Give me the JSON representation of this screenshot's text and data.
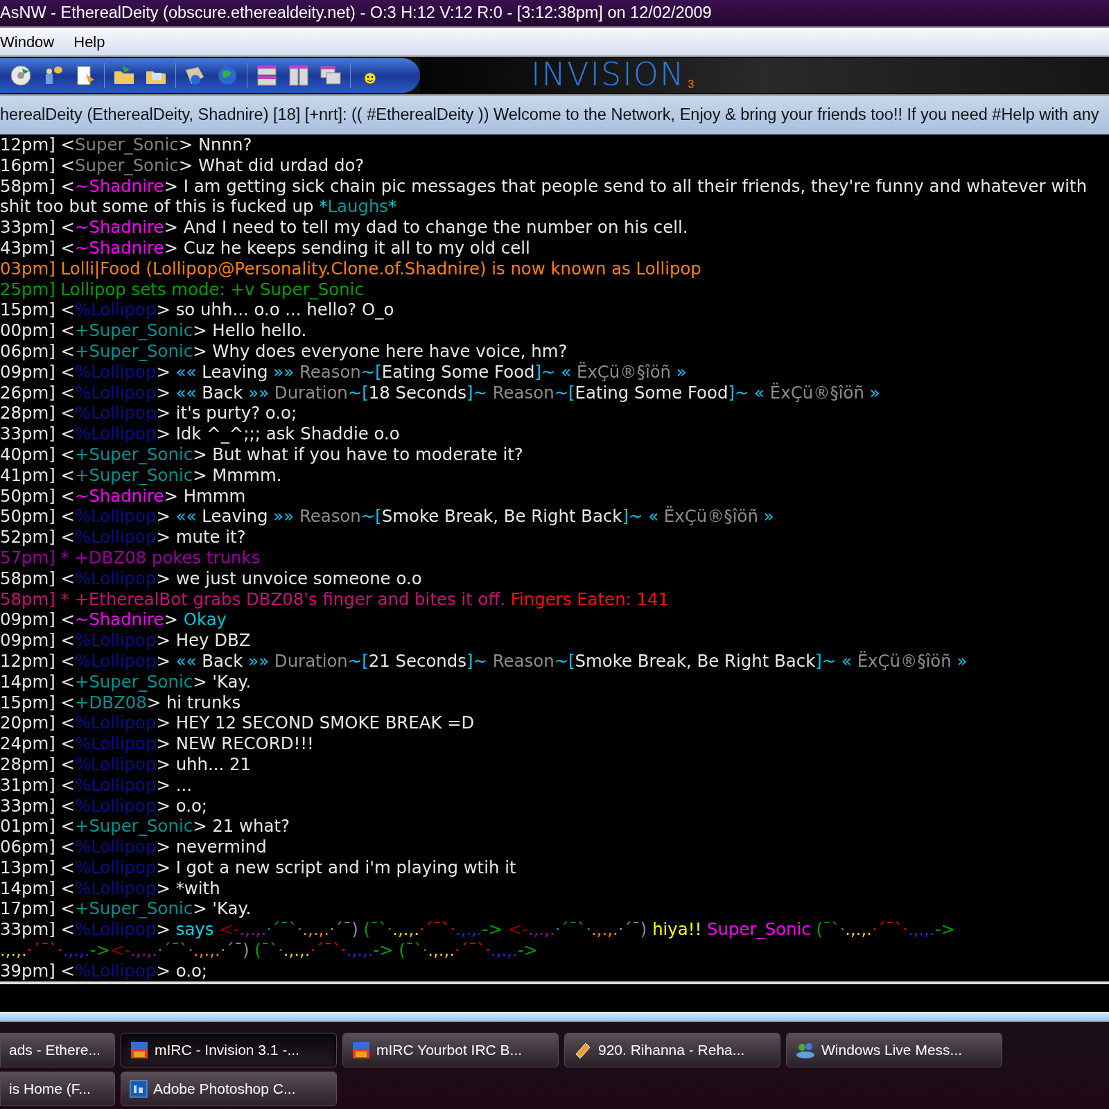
{
  "window": {
    "title": "AsNW - EtherealDeity (obscure.etherealdeity.net) - O:3 H:12 V:12 R:0 - [3:12:38pm] on 12/02/2009"
  },
  "menu": [
    "Window",
    "Help"
  ],
  "logo": {
    "text": "INVISION",
    "sub": "3"
  },
  "topic": "herealDeity (EtherealDeity, Shadnire) [18] [+nrt]: (( #EtherealDeity )) Welcome to the Network, Enjoy & bring your friends too!! If you need #Help with any",
  "chat": {
    "lines": [
      [
        {
          "text": "12pm] <",
          "color": "#e8e8e8"
        },
        {
          "text": "Super_Sonic",
          "color": "#7f7f7f"
        },
        {
          "text": "> Nnnn?",
          "color": "#e8e8e8"
        }
      ],
      [
        {
          "text": "16pm] <",
          "color": "#e8e8e8"
        },
        {
          "text": "Super_Sonic",
          "color": "#7f7f7f"
        },
        {
          "text": "> What did urdad do?",
          "color": "#e8e8e8"
        }
      ],
      [
        {
          "text": "58pm] <",
          "color": "#e8e8e8"
        },
        {
          "text": "~Shadnire",
          "color": "#ff00ff"
        },
        {
          "text": "> I am getting sick chain pic messages that people send to all their friends, they're funny and whatever with",
          "color": "#e8e8e8"
        }
      ],
      [
        {
          "text": "shit too but some of this is fucked up ",
          "color": "#e8e8e8"
        },
        {
          "text": "*",
          "color": "#00e0e0"
        },
        {
          "text": "Laughs",
          "color": "#009c9c"
        },
        {
          "text": "*",
          "color": "#00e0e0"
        }
      ],
      [
        {
          "text": "33pm] <",
          "color": "#e8e8e8"
        },
        {
          "text": "~Shadnire",
          "color": "#ff00ff"
        },
        {
          "text": "> And I need to tell my dad to change the number on his cell.",
          "color": "#e8e8e8"
        }
      ],
      [
        {
          "text": "43pm] <",
          "color": "#e8e8e8"
        },
        {
          "text": "~Shadnire",
          "color": "#ff00ff"
        },
        {
          "text": "> Cuz he keeps sending it all to my old cell",
          "color": "#e8e8e8"
        }
      ],
      [
        {
          "text": "03pm] Lolli|Food (Lollipop@Personality.Clone.of.Shadnire) is now known as Lollipop",
          "color": "#ff8000"
        }
      ],
      [
        {
          "text": "25pm] Lollipop sets mode: +v Super_Sonic",
          "color": "#00a000"
        }
      ],
      [
        {
          "text": "15pm] <",
          "color": "#e8e8e8"
        },
        {
          "text": "%Lollipop",
          "color": "#0c0c8c"
        },
        {
          "text": "> so uhh... o.o ... hello? O_o",
          "color": "#e8e8e8"
        }
      ],
      [
        {
          "text": "00pm] <",
          "color": "#e8e8e8"
        },
        {
          "text": "+Super_Sonic",
          "color": "#009393"
        },
        {
          "text": "> Hello hello.",
          "color": "#e8e8e8"
        }
      ],
      [
        {
          "text": "06pm] <",
          "color": "#e8e8e8"
        },
        {
          "text": "+Super_Sonic",
          "color": "#009393"
        },
        {
          "text": "> Why does everyone here have voice, hm?",
          "color": "#e8e8e8"
        }
      ],
      [
        {
          "text": "09pm] <",
          "color": "#e8e8e8"
        },
        {
          "text": "%Lollipop",
          "color": "#0c0c8c"
        },
        {
          "text": "> ",
          "color": "#e8e8e8"
        },
        {
          "text": "«« ",
          "color": "#00c8ff"
        },
        {
          "text": "Leaving",
          "color": "#e8e8e8"
        },
        {
          "text": " »» ",
          "color": "#00c8ff"
        },
        {
          "text": "Reason",
          "color": "#8c8c8c"
        },
        {
          "text": "~[",
          "color": "#00c8ff"
        },
        {
          "text": "Eating Some Food",
          "color": "#e8e8e8"
        },
        {
          "text": "]~ « ",
          "color": "#00c8ff"
        },
        {
          "text": "ËxÇü®§îöñ",
          "color": "#8c8c8c"
        },
        {
          "text": " »",
          "color": "#00c8ff"
        }
      ],
      [
        {
          "text": "26pm] <",
          "color": "#e8e8e8"
        },
        {
          "text": "%Lollipop",
          "color": "#0c0c8c"
        },
        {
          "text": "> ",
          "color": "#e8e8e8"
        },
        {
          "text": "«« ",
          "color": "#00c8ff"
        },
        {
          "text": "Back",
          "color": "#e8e8e8"
        },
        {
          "text": " »» ",
          "color": "#00c8ff"
        },
        {
          "text": "Duration",
          "color": "#8c8c8c"
        },
        {
          "text": "~[",
          "color": "#00c8ff"
        },
        {
          "text": "18 Seconds",
          "color": "#e8e8e8"
        },
        {
          "text": "]~ ",
          "color": "#00c8ff"
        },
        {
          "text": "Reason",
          "color": "#8c8c8c"
        },
        {
          "text": "~[",
          "color": "#00c8ff"
        },
        {
          "text": "Eating Some Food",
          "color": "#e8e8e8"
        },
        {
          "text": "]~ « ",
          "color": "#00c8ff"
        },
        {
          "text": "ËxÇü®§îöñ",
          "color": "#8c8c8c"
        },
        {
          "text": " »",
          "color": "#00c8ff"
        }
      ],
      [
        {
          "text": "28pm] <",
          "color": "#e8e8e8"
        },
        {
          "text": "%Lollipop",
          "color": "#0c0c8c"
        },
        {
          "text": "> it's purty? o.o;",
          "color": "#e8e8e8"
        }
      ],
      [
        {
          "text": "33pm] <",
          "color": "#e8e8e8"
        },
        {
          "text": "%Lollipop",
          "color": "#0c0c8c"
        },
        {
          "text": "> Idk ^_^;;; ask Shaddie o.o",
          "color": "#e8e8e8"
        }
      ],
      [
        {
          "text": "40pm] <",
          "color": "#e8e8e8"
        },
        {
          "text": "+Super_Sonic",
          "color": "#009393"
        },
        {
          "text": "> But what if you have to moderate it?",
          "color": "#e8e8e8"
        }
      ],
      [
        {
          "text": "41pm] <",
          "color": "#e8e8e8"
        },
        {
          "text": "+Super_Sonic",
          "color": "#009393"
        },
        {
          "text": "> Mmmm.",
          "color": "#e8e8e8"
        }
      ],
      [
        {
          "text": "50pm] <",
          "color": "#e8e8e8"
        },
        {
          "text": "~Shadnire",
          "color": "#ff00ff"
        },
        {
          "text": "> Hmmm",
          "color": "#e8e8e8"
        }
      ],
      [
        {
          "text": "50pm] <",
          "color": "#e8e8e8"
        },
        {
          "text": "%Lollipop",
          "color": "#0c0c8c"
        },
        {
          "text": "> ",
          "color": "#e8e8e8"
        },
        {
          "text": "«« ",
          "color": "#00c8ff"
        },
        {
          "text": "Leaving",
          "color": "#e8e8e8"
        },
        {
          "text": " »» ",
          "color": "#00c8ff"
        },
        {
          "text": "Reason",
          "color": "#8c8c8c"
        },
        {
          "text": "~[",
          "color": "#00c8ff"
        },
        {
          "text": "Smoke Break, Be Right Back",
          "color": "#e8e8e8"
        },
        {
          "text": "]~ « ",
          "color": "#00c8ff"
        },
        {
          "text": "ËxÇü®§îöñ",
          "color": "#8c8c8c"
        },
        {
          "text": " »",
          "color": "#00c8ff"
        }
      ],
      [
        {
          "text": "52pm] <",
          "color": "#e8e8e8"
        },
        {
          "text": "%Lollipop",
          "color": "#0c0c8c"
        },
        {
          "text": "> mute it?",
          "color": "#e8e8e8"
        }
      ],
      [
        {
          "text": "57pm] * +DBZ08 pokes trunks",
          "color": "#9c009c"
        }
      ],
      [
        {
          "text": "58pm] <",
          "color": "#e8e8e8"
        },
        {
          "text": "%Lollipop",
          "color": "#0c0c8c"
        },
        {
          "text": "> we just unvoice someone o.o",
          "color": "#e8e8e8"
        }
      ],
      [
        {
          "text": "58pm] * +EtherealBot grabs DBZ08's finger and bites it off. ",
          "color": "#c8107a"
        },
        {
          "text": "Fingers Eaten: 141",
          "color": "#ff1010"
        }
      ],
      [
        {
          "text": "09pm] <",
          "color": "#e8e8e8"
        },
        {
          "text": "~Shadnire",
          "color": "#ff00ff"
        },
        {
          "text": "> ",
          "color": "#e8e8e8"
        },
        {
          "text": "Okay",
          "color": "#00c8d8"
        }
      ],
      [
        {
          "text": "09pm] <",
          "color": "#e8e8e8"
        },
        {
          "text": "%Lollipop",
          "color": "#0c0c8c"
        },
        {
          "text": "> Hey DBZ",
          "color": "#e8e8e8"
        }
      ],
      [
        {
          "text": "12pm] <",
          "color": "#e8e8e8"
        },
        {
          "text": "%Lollipop",
          "color": "#0c0c8c"
        },
        {
          "text": "> ",
          "color": "#e8e8e8"
        },
        {
          "text": "«« ",
          "color": "#00c8ff"
        },
        {
          "text": "Back",
          "color": "#e8e8e8"
        },
        {
          "text": " »» ",
          "color": "#00c8ff"
        },
        {
          "text": "Duration",
          "color": "#8c8c8c"
        },
        {
          "text": "~[",
          "color": "#00c8ff"
        },
        {
          "text": "21 Seconds",
          "color": "#e8e8e8"
        },
        {
          "text": "]~ ",
          "color": "#00c8ff"
        },
        {
          "text": "Reason",
          "color": "#8c8c8c"
        },
        {
          "text": "~[",
          "color": "#00c8ff"
        },
        {
          "text": "Smoke Break, Be Right Back",
          "color": "#e8e8e8"
        },
        {
          "text": "]~ « ",
          "color": "#00c8ff"
        },
        {
          "text": "ËxÇü®§îöñ",
          "color": "#8c8c8c"
        },
        {
          "text": " »",
          "color": "#00c8ff"
        }
      ],
      [
        {
          "text": "14pm] <",
          "color": "#e8e8e8"
        },
        {
          "text": "+Super_Sonic",
          "color": "#009393"
        },
        {
          "text": "> 'Kay.",
          "color": "#e8e8e8"
        }
      ],
      [
        {
          "text": "15pm] <",
          "color": "#e8e8e8"
        },
        {
          "text": "+DBZ08",
          "color": "#009393"
        },
        {
          "text": "> hi trunks",
          "color": "#e8e8e8"
        }
      ],
      [
        {
          "text": "20pm] <",
          "color": "#e8e8e8"
        },
        {
          "text": "%Lollipop",
          "color": "#0c0c8c"
        },
        {
          "text": "> HEY 12 SECOND SMOKE BREAK =D",
          "color": "#e8e8e8"
        }
      ],
      [
        {
          "text": "24pm] <",
          "color": "#e8e8e8"
        },
        {
          "text": "%Lollipop",
          "color": "#0c0c8c"
        },
        {
          "text": "> NEW RECORD!!!",
          "color": "#e8e8e8"
        }
      ],
      [
        {
          "text": "28pm] <",
          "color": "#e8e8e8"
        },
        {
          "text": "%Lollipop",
          "color": "#0c0c8c"
        },
        {
          "text": "> uhh... 21",
          "color": "#e8e8e8"
        }
      ],
      [
        {
          "text": "31pm] <",
          "color": "#e8e8e8"
        },
        {
          "text": "%Lollipop",
          "color": "#0c0c8c"
        },
        {
          "text": "> ...",
          "color": "#e8e8e8"
        }
      ],
      [
        {
          "text": "33pm] <",
          "color": "#e8e8e8"
        },
        {
          "text": "%Lollipop",
          "color": "#0c0c8c"
        },
        {
          "text": "> o.o;",
          "color": "#e8e8e8"
        }
      ],
      [
        {
          "text": "01pm] <",
          "color": "#e8e8e8"
        },
        {
          "text": "+Super_Sonic",
          "color": "#009393"
        },
        {
          "text": "> 21 what?",
          "color": "#e8e8e8"
        }
      ],
      [
        {
          "text": "06pm] <",
          "color": "#e8e8e8"
        },
        {
          "text": "%Lollipop",
          "color": "#0c0c8c"
        },
        {
          "text": "> nevermind",
          "color": "#e8e8e8"
        }
      ],
      [
        {
          "text": "13pm] <",
          "color": "#e8e8e8"
        },
        {
          "text": "%Lollipop",
          "color": "#0c0c8c"
        },
        {
          "text": "> I got a new script and i'm playing wtih it",
          "color": "#e8e8e8"
        }
      ],
      [
        {
          "text": "14pm] <",
          "color": "#e8e8e8"
        },
        {
          "text": "%Lollipop",
          "color": "#0c0c8c"
        },
        {
          "text": "> *with",
          "color": "#e8e8e8"
        }
      ],
      [
        {
          "text": "17pm] <",
          "color": "#e8e8e8"
        },
        {
          "text": "+Super_Sonic",
          "color": "#009393"
        },
        {
          "text": "> 'Kay.",
          "color": "#e8e8e8"
        }
      ],
      [
        {
          "text": "33pm] <",
          "color": "#e8e8e8"
        },
        {
          "text": "%Lollipop",
          "color": "#0c0c8c"
        },
        {
          "text": "> ",
          "color": "#e8e8e8"
        },
        {
          "text": "says ",
          "color": "#00d8e8"
        },
        {
          "text": "<-",
          "color": "#8c0000"
        },
        {
          "text": ".,.,.",
          "color": "#a000a0"
        },
        {
          "text": "·´¯`·",
          "color": "#009090"
        },
        {
          "text": ".,.,.",
          "color": "#ff8000"
        },
        {
          "text": "·´¯)",
          "color": "#8a8aa0"
        },
        {
          "text": " (¯`·",
          "color": "#00a000"
        },
        {
          "text": ".,.,.",
          "color": "#e8d000"
        },
        {
          "text": "·´¯`·",
          "color": "#ff0000"
        },
        {
          "text": ".,.,.",
          "color": "#2020ff"
        },
        {
          "text": "->",
          "color": "#00a000"
        },
        {
          "text": " <-",
          "color": "#8c0000"
        },
        {
          "text": ".,.,.",
          "color": "#a000a0"
        },
        {
          "text": "·´¯`·",
          "color": "#009090"
        },
        {
          "text": ".,.,.",
          "color": "#ff8000"
        },
        {
          "text": "·´¯)",
          "color": "#8a8aa0"
        },
        {
          "text": " hiya!! ",
          "color": "#ffff00"
        },
        {
          "text": "Super_Sonic",
          "color": "#ff00ff"
        },
        {
          "text": " (¯`·",
          "color": "#00a000"
        },
        {
          "text": ".,.,.",
          "color": "#e8d000"
        },
        {
          "text": "·´¯`·",
          "color": "#ff0000"
        },
        {
          "text": ".,.,.",
          "color": "#2020ff"
        },
        {
          "text": "->",
          "color": "#00a000"
        }
      ],
      [
        {
          "text": ".,.,.",
          "color": "#e8d000"
        },
        {
          "text": "·´¯`·",
          "color": "#ff0000"
        },
        {
          "text": ".,.,.",
          "color": "#2020ff"
        },
        {
          "text": "->",
          "color": "#00a000"
        },
        {
          "text": "<-",
          "color": "#8c0000"
        },
        {
          "text": ".,.,.",
          "color": "#a000a0"
        },
        {
          "text": "·´¯`·",
          "color": "#009090"
        },
        {
          "text": ".,.,.",
          "color": "#ff8000"
        },
        {
          "text": "·´¯)",
          "color": "#8a8aa0"
        },
        {
          "text": " (¯`·",
          "color": "#00a000"
        },
        {
          "text": ".,.,.",
          "color": "#e8d000"
        },
        {
          "text": "·´¯`·",
          "color": "#ff0000"
        },
        {
          "text": ".,.,.",
          "color": "#2020ff"
        },
        {
          "text": "->",
          "color": "#00a000"
        },
        {
          "text": " (¯`·",
          "color": "#00a000"
        },
        {
          "text": ".,.,.",
          "color": "#e8d000"
        },
        {
          "text": "·´¯`·",
          "color": "#ff0000"
        },
        {
          "text": ".,.,.",
          "color": "#2020ff"
        },
        {
          "text": "->",
          "color": "#00a000"
        }
      ],
      [
        {
          "text": "39pm] <",
          "color": "#e8e8e8"
        },
        {
          "text": "%Lollipop",
          "color": "#0c0c8c"
        },
        {
          "text": "> o.o;",
          "color": "#e8e8e8"
        }
      ]
    ]
  },
  "taskbar": {
    "rows": [
      [
        {
          "label": "ads - Ethere...",
          "selected": false
        },
        {
          "label": "mIRC - Invision 3.1 -...",
          "selected": true
        },
        {
          "label": "mIRC Yourbot IRC B...",
          "selected": false
        },
        {
          "label": "920. Rihanna - Reha...",
          "selected": false
        },
        {
          "label": "Windows Live Mess...",
          "selected": false
        }
      ],
      [
        {
          "label": "is Home  (F...",
          "selected": false
        },
        {
          "label": "Adobe Photoshop C...",
          "selected": false
        }
      ]
    ]
  }
}
